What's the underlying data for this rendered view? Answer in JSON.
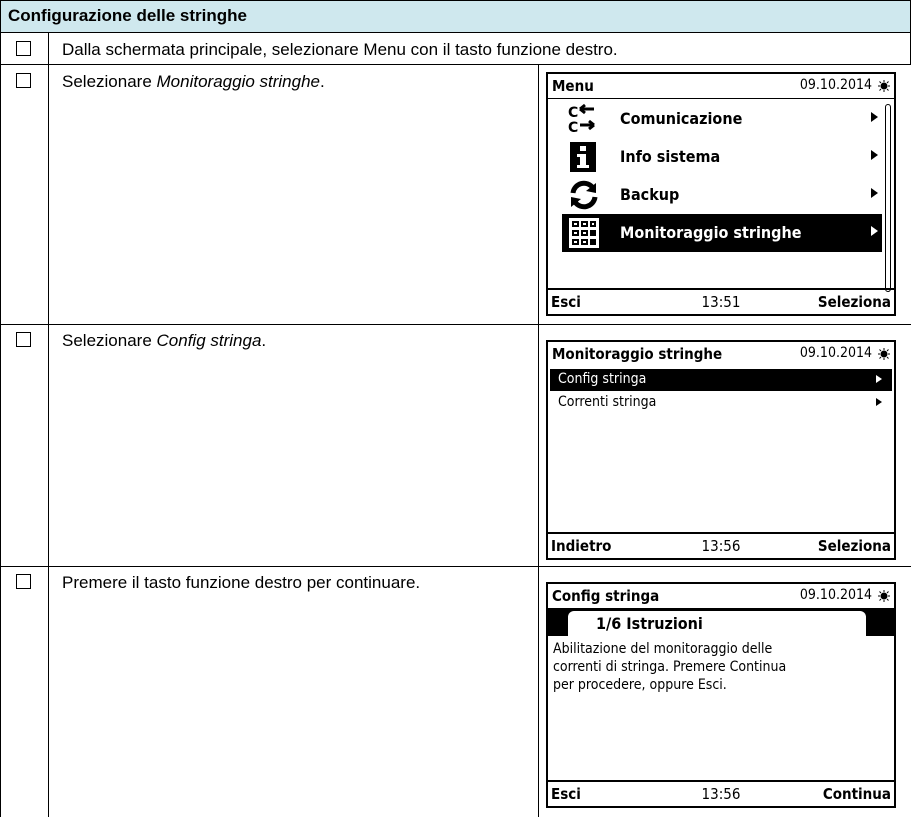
{
  "header": {
    "title": "Configurazione delle stringhe"
  },
  "steps": [
    {
      "text": "Dalla schermata principale, selezionare Menu con il tasto funzione destro."
    },
    {
      "prefix": "Selezionare ",
      "emph": "Monitoraggio stringhe",
      "suffix": "."
    },
    {
      "prefix": "Selezionare ",
      "emph": "Config stringa",
      "suffix": "."
    },
    {
      "text": "Premere il tasto funzione destro per continuare."
    }
  ],
  "screen1": {
    "title": "Menu",
    "date": "09.10.2014",
    "items": [
      {
        "label": "Comunicazione",
        "icon": "communication-icon"
      },
      {
        "label": "Info sistema",
        "icon": "info-icon"
      },
      {
        "label": "Backup",
        "icon": "backup-icon"
      },
      {
        "label": "Monitoraggio stringhe",
        "icon": "string-monitor-icon",
        "selected": true
      }
    ],
    "footer": {
      "left": "Esci",
      "center": "13:51",
      "right": "Seleziona"
    }
  },
  "screen2": {
    "title": "Monitoraggio stringhe",
    "date": "09.10.2014",
    "items": [
      {
        "label": "Config stringa",
        "selected": true
      },
      {
        "label": "Correnti stringa"
      }
    ],
    "footer": {
      "left": "Indietro",
      "center": "13:56",
      "right": "Seleziona"
    }
  },
  "screen3": {
    "title": "Config stringa",
    "date": "09.10.2014",
    "tab": "1/6 Istruzioni",
    "body": "Abilitazione del monitoraggio delle\ncorrenti di stringa. Premere Continua\nper procedere, oppure Esci.",
    "footer": {
      "left": "Esci",
      "center": "13:56",
      "right": "Continua"
    }
  }
}
